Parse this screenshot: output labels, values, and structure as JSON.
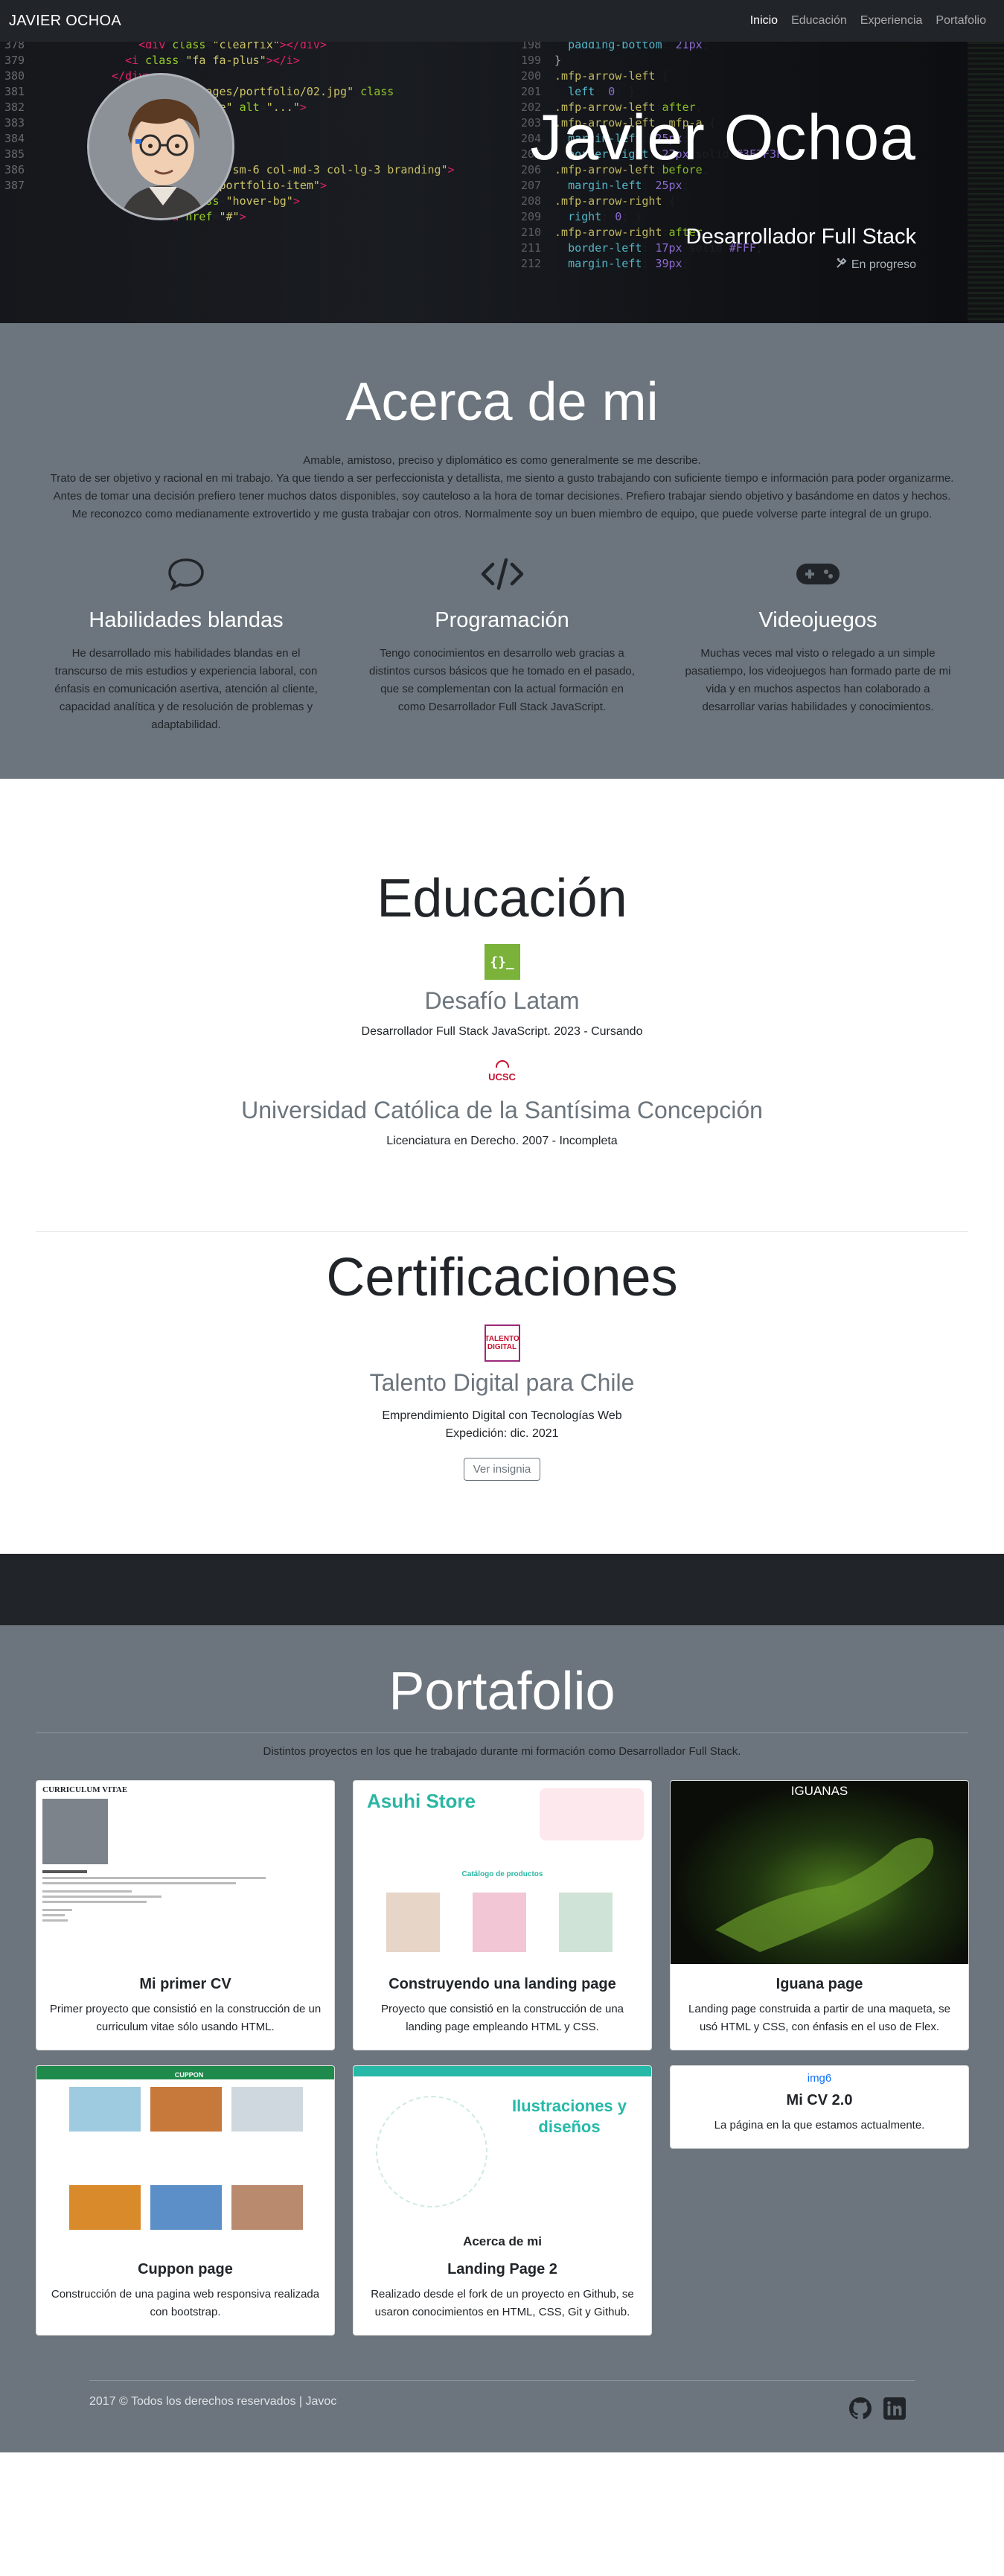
{
  "navbar": {
    "brand": "JAVIER OCHOA",
    "links": [
      "Inicio",
      "Educación",
      "Experiencia",
      "Portafolio"
    ]
  },
  "hero": {
    "title": "Javier Ochoa",
    "subtitle": "Desarrollador Full Stack",
    "status": "En progreso"
  },
  "about": {
    "title": "Acerca de mi",
    "paragraphs": [
      "Amable, amistoso, preciso y diplomático es como generalmente se me describe.",
      "Trato de ser objetivo y racional en mi trabajo. Ya que tiendo a ser perfeccionista y detallista, me siento a gusto trabajando con suficiente tiempo e información para poder organizarme.",
      "Antes de tomar una decisión prefiero tener muchos datos disponibles, soy cauteloso a la hora de tomar decisiones. Prefiero trabajar siendo objetivo y basándome en datos y hechos.",
      "Me reconozco como medianamente extrovertido y me gusta trabajar con otros. Normalmente soy un buen miembro de equipo, que puede volverse parte integral de un grupo."
    ],
    "features": [
      {
        "icon": "chat-bubble-icon",
        "title": "Habilidades blandas",
        "text": "He desarrollado mis habilidades blandas en el transcurso de mis estudios y experiencia laboral, con énfasis en comunicación asertiva, atención al cliente, capacidad analítica y de resolución de problemas y adaptabilidad."
      },
      {
        "icon": "code-icon",
        "title": "Programación",
        "text": "Tengo conocimientos en desarrollo web gracias a distintos cursos básicos que he tomado en el pasado, que se complementan con la actual formación en como Desarrollador Full Stack JavaScript."
      },
      {
        "icon": "gamepad-icon",
        "title": "Videojuegos",
        "text": "Muchas veces mal visto o relegado a un simple pasatiempo, los videojuegos han formado parte de mi vida y en muchos aspectos han colaborado a desarrollar varias habilidades y conocimientos."
      }
    ]
  },
  "education": {
    "title": "Educación",
    "items": [
      {
        "logo_text": "{}_",
        "name": "Desafío Latam",
        "desc": "Desarrollador Full Stack JavaScript. 2023 - Cursando"
      },
      {
        "logo_text": "UCSC",
        "name": "Universidad Católica de la Santísima Concepción",
        "desc": "Licenciatura en Derecho. 2007 - Incompleta"
      }
    ]
  },
  "certifications": {
    "title": "Certificaciones",
    "logo_text": "TALENTO DIGITAL",
    "name": "Talento Digital para Chile",
    "desc1": "Emprendimiento Digital con Tecnologías Web",
    "desc2": "Expedición: dic. 2021",
    "button": "Ver insignia"
  },
  "portfolio": {
    "title": "Portafolio",
    "subtitle": "Distintos proyectos en los que he trabajado durante mi formación como Desarrollador Full Stack.",
    "cards": [
      {
        "title": "Mi primer CV",
        "text": "Primer proyecto que consistió en la construcción de un curriculum vitae sólo usando HTML.",
        "thumb_heading": "CURRICULUM VITAE"
      },
      {
        "title": "Construyendo una landing page",
        "text": "Proyecto que consistió en la construcción de una landing page empleando HTML y CSS.",
        "thumb_heading": "Asuhi Store",
        "thumb_sub": "Catálogo de productos"
      },
      {
        "title": "Iguana page",
        "text": "Landing page construida a partir de una maqueta, se usó HTML y CSS, con énfasis en el uso de Flex.",
        "thumb_heading": "IGUANAS"
      },
      {
        "title": "Cuppon page",
        "text": "Construcción de una pagina web responsiva realizada con bootstrap.",
        "thumb_heading": "CUPPON"
      },
      {
        "title": "Landing Page 2",
        "text": "Realizado desde el fork de un proyecto en Github, se usaron conocimientos en HTML, CSS, Git y Github.",
        "thumb_heading": "Ilustraciones y diseños",
        "thumb_sub": "Acerca de mi"
      },
      {
        "title": "Mi CV 2.0",
        "text": "La página en la que estamos actualmente.",
        "img_alt": "img6"
      }
    ]
  },
  "footer": {
    "text": "2017 © Todos los derechos reservados | Javoc",
    "icons": [
      "github-icon",
      "linkedin-icon"
    ]
  },
  "colors": {
    "dark": "#212529",
    "gray": "#6c757d",
    "white": "#ffffff",
    "link": "#0d6efd"
  }
}
